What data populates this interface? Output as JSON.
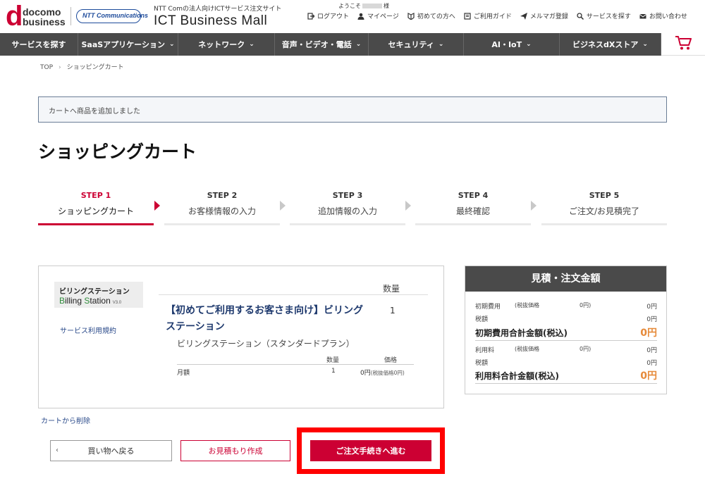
{
  "header": {
    "brand": {
      "d": "d",
      "line1": "docomo",
      "line2": "business"
    },
    "partner_logo": "NTT Communications",
    "subtitle": "NTT Comの法人向けICTサービス注文サイト",
    "title": "ICT Business Mall",
    "welcome_prefix": "ようこそ",
    "welcome_suffix": "様",
    "links": [
      {
        "icon": "logout-icon",
        "label": "ログアウト"
      },
      {
        "icon": "user-icon",
        "label": "マイページ"
      },
      {
        "icon": "beginner-icon",
        "label": "初めての方へ"
      },
      {
        "icon": "guide-book-icon",
        "label": "ご利用ガイド"
      },
      {
        "icon": "paper-plane-icon",
        "label": "メルマガ登録"
      },
      {
        "icon": "search-icon",
        "label": "サービスを探す"
      },
      {
        "icon": "mail-icon",
        "label": "お問い合わせ"
      }
    ]
  },
  "nav": [
    {
      "label": "サービスを探す"
    },
    {
      "label": "SaaSアプリケーション"
    },
    {
      "label": "ネットワーク"
    },
    {
      "label": "音声・ビデオ・電話"
    },
    {
      "label": "セキュリティ"
    },
    {
      "label": "AI・IoT"
    },
    {
      "label": "ビジネスdXストア"
    }
  ],
  "breadcrumb": {
    "home": "TOP",
    "current": "ショッピングカート"
  },
  "notice": "カートへ商品を追加しました",
  "page_title": "ショッピングカート",
  "steps": [
    {
      "num": "STEP 1",
      "label": "ショッピングカート"
    },
    {
      "num": "STEP 2",
      "label": "お客様情報の入力"
    },
    {
      "num": "STEP 3",
      "label": "追加情報の入力"
    },
    {
      "num": "STEP 4",
      "label": "最終確認"
    },
    {
      "num": "STEP 5",
      "label": "ご注文/お見積完了"
    }
  ],
  "cart": {
    "logo_jp": "ビリングステーション",
    "logo_en_b": "B",
    "logo_en_illing": "illing ",
    "logo_en_s": "S",
    "logo_en_tation": "tation",
    "logo_ver": "V3.0",
    "terms_link": "サービス利用規約",
    "qty_header": "数量",
    "product_title": "【初めてご利用するお客さま向け】ビリングステーション",
    "product_qty": "1",
    "plan_name": "ビリングステーション（スタンダードプラン）",
    "price_headers": {
      "qty": "数量",
      "price": "価格"
    },
    "price_row": {
      "label": "月額",
      "qty": "1",
      "price": "0円",
      "price_note": "(税抜価格0円)"
    },
    "remove_link": "カートから削除"
  },
  "summary": {
    "title": "見積・注文金額",
    "initial_label": "初期費用",
    "tax_excl_label": "(税抜価格",
    "initial_tax_excl": "0円)",
    "initial_value": "0円",
    "tax_label": "税額",
    "initial_tax_value": "0円",
    "initial_total_label": "初期費用合計金額(税込)",
    "initial_total": "0円",
    "usage_label": "利用料",
    "usage_tax_excl": "0円)",
    "usage_value": "0円",
    "usage_tax_value": "0円",
    "usage_total_label": "利用料合計金額(税込)",
    "usage_total": "0円"
  },
  "buttons": {
    "back": "買い物へ戻る",
    "quote": "お見積もり作成",
    "order": "ご注文手続きへ進む"
  },
  "colors": {
    "accent": "#cc0033",
    "nav_bg": "#4a4a4a",
    "price_orange": "#e68a3a",
    "highlight": "#ff0000"
  }
}
